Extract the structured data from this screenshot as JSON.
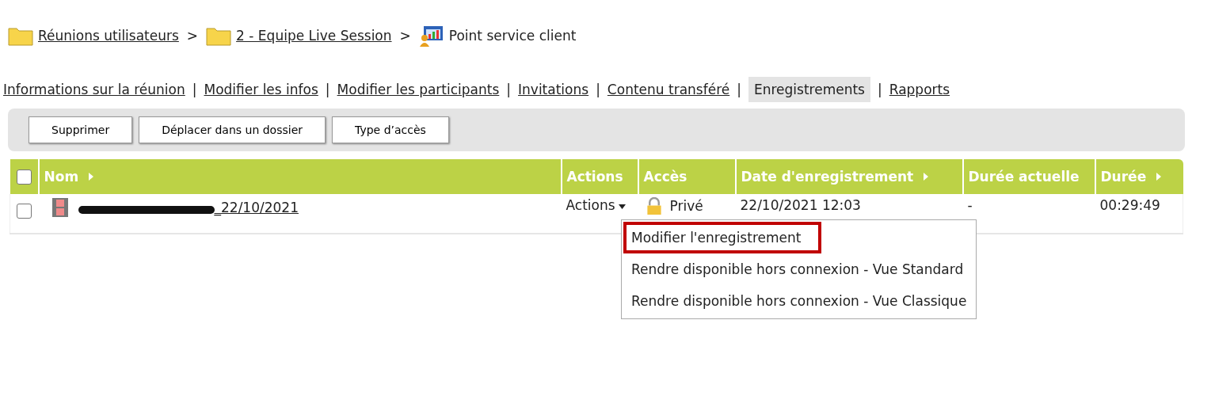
{
  "breadcrumb": [
    {
      "label": "Réunions utilisateurs",
      "kind": "folder",
      "link": true
    },
    {
      "label": "2 - Equipe Live Session",
      "kind": "folder",
      "link": true
    },
    {
      "label": "Point service client",
      "kind": "meeting",
      "link": false
    }
  ],
  "separator": ">",
  "tabs": [
    {
      "label": "Informations sur la réunion",
      "selected": false
    },
    {
      "label": "Modifier les infos",
      "selected": false
    },
    {
      "label": "Modifier les participants",
      "selected": false
    },
    {
      "label": "Invitations",
      "selected": false
    },
    {
      "label": "Contenu transféré",
      "selected": false
    },
    {
      "label": "Enregistrements",
      "selected": true
    },
    {
      "label": "Rapports",
      "selected": false
    }
  ],
  "tab_separator": "|",
  "toolbar": [
    "Supprimer",
    "Déplacer dans un dossier",
    "Type d’accès"
  ],
  "table": {
    "select_all": {
      "checked": false
    },
    "columns": [
      {
        "label": "Nom",
        "sortable": true
      },
      {
        "label": "Actions",
        "sortable": false
      },
      {
        "label": "Accès",
        "sortable": false
      },
      {
        "label": "Date d'enregistrement",
        "sortable": true
      },
      {
        "label": "Durée actuelle",
        "sortable": false
      },
      {
        "label": "Durée",
        "sortable": true
      }
    ],
    "rows": [
      {
        "checked": false,
        "name": "_22/10/2021",
        "name_redacted": true,
        "actions": "Actions",
        "access": "Privé",
        "date": "22/10/2021 12:03",
        "current_duration": "-",
        "duration": "00:29:49"
      }
    ]
  },
  "actions_menu": [
    {
      "label": "Modifier l'enregistrement",
      "highlighted": true
    },
    {
      "label": "Rendre disponible hors connexion - Vue Standard",
      "highlighted": false
    },
    {
      "label": "Rendre disponible hors connexion - Vue Classique",
      "highlighted": false
    }
  ]
}
